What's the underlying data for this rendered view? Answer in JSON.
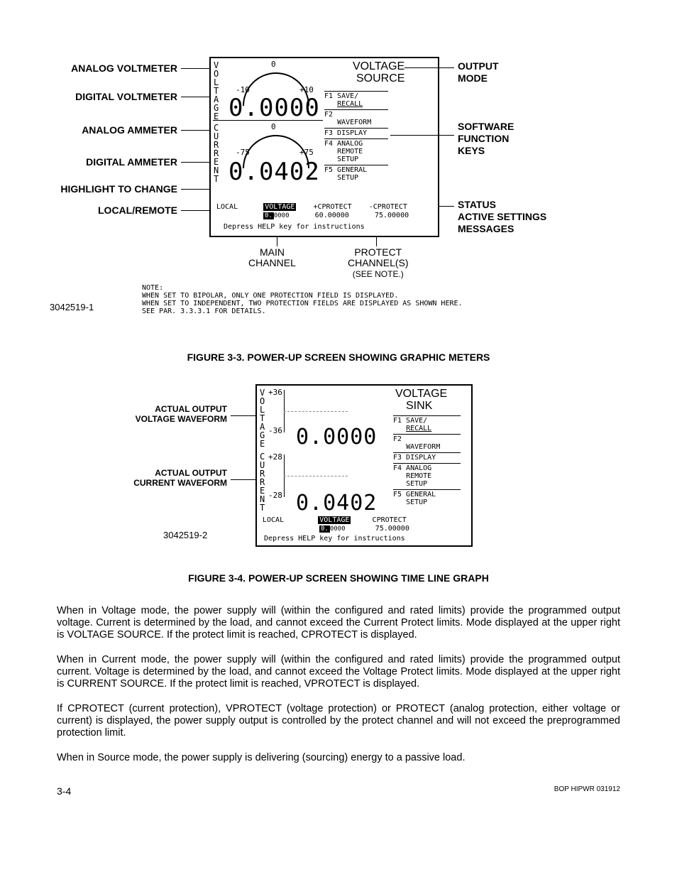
{
  "figure1": {
    "labels_left": {
      "analog_voltmeter": "ANALOG VOLTMETER",
      "digital_voltmeter": "DIGITAL VOLTMETER",
      "analog_ammeter": "ANALOG AMMETER",
      "digital_ammeter": "DIGITAL AMMETER",
      "highlight": "HIGHLIGHT TO CHANGE",
      "local_remote": "LOCAL/REMOTE"
    },
    "labels_right": {
      "voltage_source": "VOLTAGE\nSOURCE",
      "output_mode": "OUTPUT\nMODE",
      "software_keys": "SOFTWARE\nFUNCTION\nKEYS",
      "status": "STATUS\nACTIVE SETTINGS\nMESSAGES"
    },
    "lcd": {
      "vtext_voltage": "VOLTAGE",
      "vtext_current": "CURRENT",
      "volt_neg": "-10",
      "volt_zero": "0",
      "volt_pos": "+10",
      "cur_neg": "-75",
      "cur_zero": "0",
      "cur_pos": "+75",
      "digital_v": "0.0000",
      "digital_a": "0.0402",
      "mode_voltage": "VOLTAGE",
      "mode_source": "SOURCE",
      "fkeys": {
        "f1": "F1 SAVE/",
        "f1b": "RECALL",
        "f2": "F2",
        "f2b": "WAVEFORM",
        "f3": "F3 DISPLAY",
        "f4": "F4 ANALOG",
        "f4b": "REMOTE",
        "f4c": "SETUP",
        "f5": "F5 GENERAL",
        "f5b": "SETUP"
      },
      "status": {
        "local": "LOCAL",
        "voltage_hi": "VOLTAGE",
        "voltage_val": "0.0000",
        "cprot_p": "+CPROTECT",
        "cprot_p_val": "60.00000",
        "cprot_n": "-CPROTECT",
        "cprot_n_val": "75.00000",
        "help": "Depress HELP key for instructions"
      }
    },
    "chlabels": {
      "main": "MAIN\nCHANNEL",
      "protect": "PROTECT\nCHANNEL(S)\n(SEE NOTE.)"
    },
    "note_heading": "NOTE:",
    "note_line1": "WHEN SET TO BIPOLAR, ONLY ONE PROTECTION FIELD IS DISPLAYED.",
    "note_line2": "WHEN SET TO INDEPENDENT, TWO PROTECTION FIELDS ARE DISPLAYED AS SHOWN HERE.",
    "note_line3": "SEE PAR. 3.3.3.1 FOR DETAILS.",
    "doc_num": "3042519-1",
    "caption": "FIGURE 3-3.    POWER-UP SCREEN SHOWING GRAPHIC METERS"
  },
  "figure2": {
    "labels_left": {
      "volt_wave": "ACTUAL OUTPUT\nVOLTAGE WAVEFORM",
      "cur_wave": "ACTUAL OUTPUT\nCURRENT WAVEFORM"
    },
    "lcd": {
      "vtext_voltage": "VOLTAGE",
      "vtext_current": "CURRENT",
      "v_pos": "+36",
      "v_neg": "-36",
      "c_pos": "+28",
      "c_neg": "-28",
      "digital_v": "0.0000",
      "digital_a": "0.0402",
      "mode_voltage": "VOLTAGE",
      "mode_sink": "SINK",
      "fkeys": {
        "f1": "F1 SAVE/",
        "f1b": "RECALL",
        "f2": "F2",
        "f2b": "WAVEFORM",
        "f3": "F3 DISPLAY",
        "f4": "F4 ANALOG",
        "f4b": "REMOTE",
        "f4c": "SETUP",
        "f5": "F5 GENERAL",
        "f5b": "SETUP"
      },
      "status": {
        "local": "LOCAL",
        "voltage_hi": "VOLTAGE",
        "voltage_val": "0.0000",
        "cprot": "CPROTECT",
        "cprot_val": "75.00000",
        "help": "Depress HELP key for instructions"
      }
    },
    "doc_num": "3042519-2",
    "caption": "FIGURE 3-4.    POWER-UP SCREEN SHOWING TIME LINE GRAPH"
  },
  "paragraphs": {
    "p1": "When in Voltage mode, the power supply will (within the configured and rated limits) provide the programmed output voltage. Current is determined by the load, and cannot exceed the Current Protect limits. Mode displayed at the upper right is VOLTAGE SOURCE. If the protect limit is reached, CPROTECT is displayed.",
    "p2": "When in Current mode, the power supply will (within the configured and rated limits) provide the programmed output current. Voltage is determined by the load, and cannot exceed the Voltage Protect limits. Mode displayed at the upper right is CURRENT SOURCE. If the protect limit is reached, VPROTECT is displayed.",
    "p3": "If CPROTECT (current protection), VPROTECT (voltage protection) or PROTECT (analog protection, either voltage or current) is displayed, the power supply output is controlled by the protect channel and will not exceed the preprogrammed protection limit.",
    "p4": "When in Source mode, the power supply is delivering (sourcing) energy to a passive load."
  },
  "footer": {
    "page": "3-4",
    "doc": "BOP HIPWR 031912"
  }
}
